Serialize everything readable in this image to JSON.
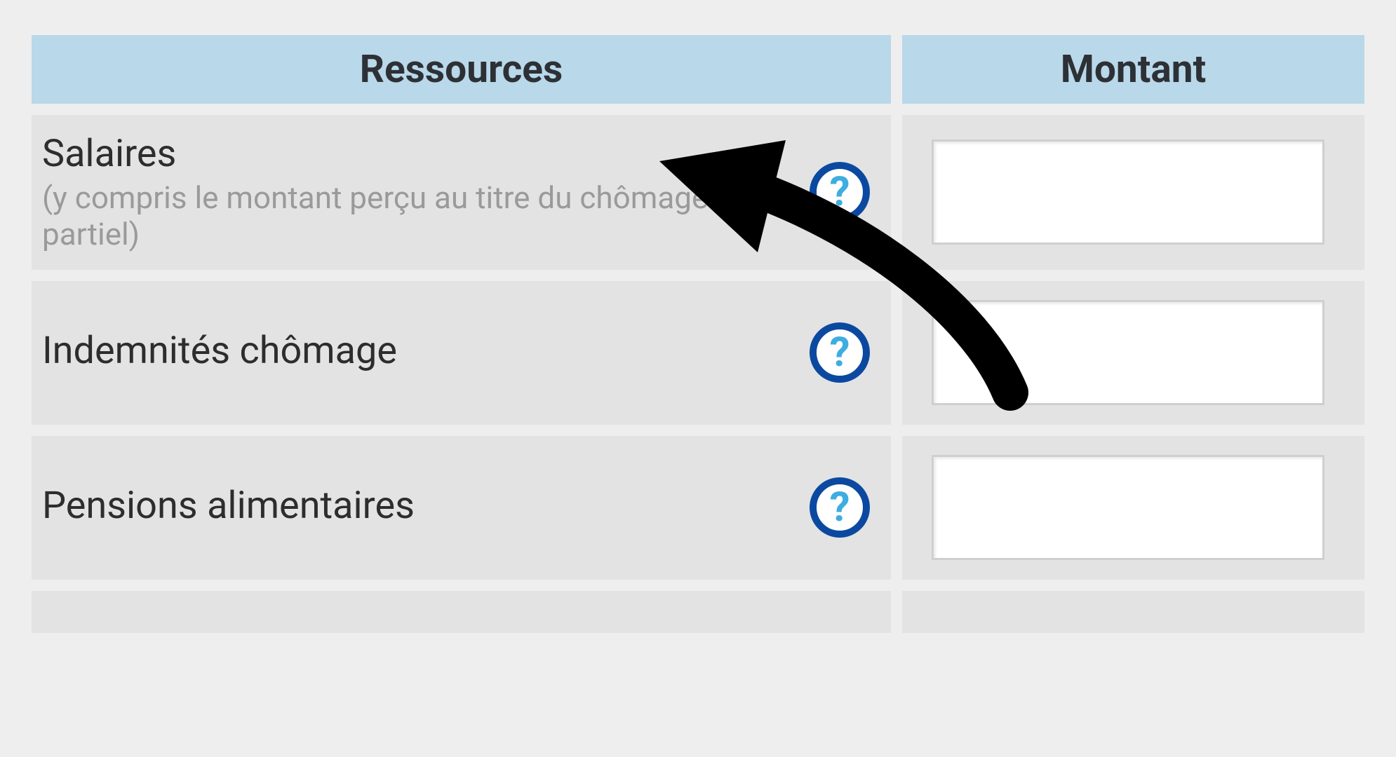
{
  "table": {
    "headers": {
      "resources": "Ressources",
      "amount": "Montant"
    },
    "rows": [
      {
        "label": "Salaires",
        "sublabel": "(y compris le montant perçu au titre du chômage partiel)",
        "value": ""
      },
      {
        "label": "Indemnités chômage",
        "sublabel": "",
        "value": ""
      },
      {
        "label": "Pensions alimentaires",
        "sublabel": "",
        "value": ""
      }
    ]
  },
  "icons": {
    "help_glyph": "?"
  }
}
